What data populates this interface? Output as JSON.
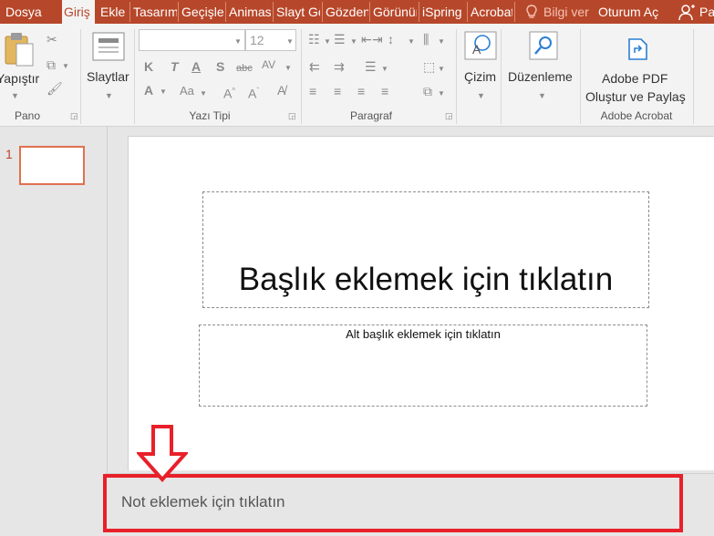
{
  "tabs": [
    {
      "label": "Dosya"
    },
    {
      "label": "Giriş"
    },
    {
      "label": "Ekle"
    },
    {
      "label": "Tasarım"
    },
    {
      "label": "Geçişler"
    },
    {
      "label": "Animasyonlar"
    },
    {
      "label": "Slayt Gösterisi"
    },
    {
      "label": "Gözden Geçir"
    },
    {
      "label": "Görünüm"
    },
    {
      "label": "iSpring"
    },
    {
      "label": "Acrobat"
    }
  ],
  "tellme": "Bilgi ver",
  "signin": "Oturum Aç",
  "share": "Paylaş",
  "ribbon": {
    "paste_label": "Yapıştır",
    "slides_label": "Slaytlar",
    "font_size": "12",
    "draw_label": "Çizim",
    "edit_label": "Düzenleme",
    "adobe_line1": "Adobe PDF",
    "adobe_line2": "Oluştur ve Paylaş",
    "groups": {
      "pano": "Pano",
      "font": "Yazı Tipi",
      "paragraph": "Paragraf",
      "acrobat": "Adobe Acrobat"
    }
  },
  "thumb_number": "1",
  "slide": {
    "title_placeholder": "Başlık eklemek için tıklatın",
    "subtitle_placeholder": "Alt başlık eklemek için tıklatın"
  },
  "notes_placeholder": "Not eklemek için tıklatın",
  "colors": {
    "accent": "#b7472a",
    "annotation": "#e8202a"
  }
}
